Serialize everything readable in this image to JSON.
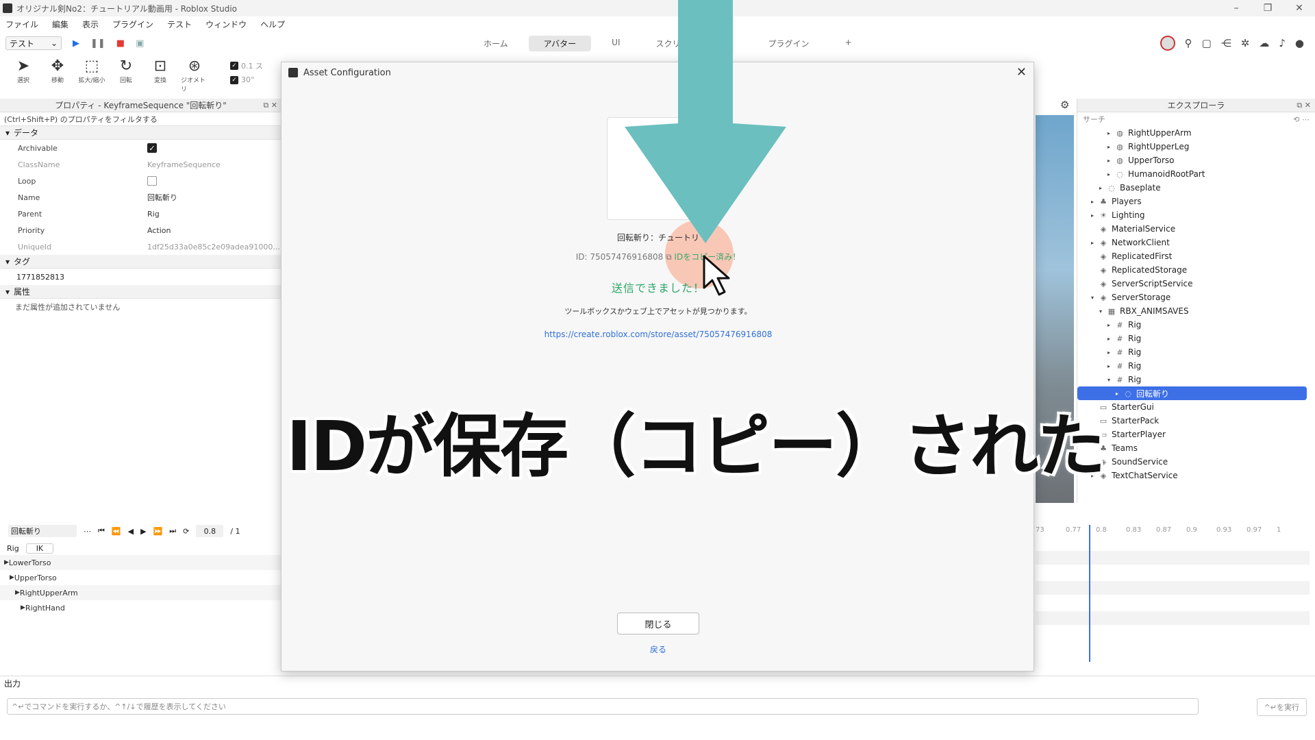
{
  "window": {
    "title": "オリジナル剣No2：チュートリアル動画用 - Roblox Studio"
  },
  "menu": [
    "ファイル",
    "編集",
    "表示",
    "プラグイン",
    "テスト",
    "ウィンドウ",
    "ヘルプ"
  ],
  "toolbar": {
    "test_select": "テスト",
    "ribbon_tabs": [
      "ホーム",
      "アバター",
      "UI",
      "スクリプト",
      "",
      "プラグイン",
      "+"
    ],
    "active_tab": "アバター",
    "tools": [
      {
        "label": "選択",
        "icon": "select-arrow-icon"
      },
      {
        "label": "移動",
        "icon": "move-icon"
      },
      {
        "label": "拡大/縮小",
        "icon": "scale-icon"
      },
      {
        "label": "回転",
        "icon": "rotate-icon"
      },
      {
        "label": "変換",
        "icon": "transform-icon"
      },
      {
        "label": "ジオメトリ",
        "icon": "geometry-icon"
      }
    ],
    "snap_move": "0.1 ス",
    "snap_rotate": "30°"
  },
  "properties": {
    "header": "プロパティ - KeyframeSequence \"回転斬り\"",
    "filter_placeholder": "(Ctrl+Shift+P) のプロパティをフィルタする",
    "section_data": "データ",
    "rows": [
      {
        "key": "Archivable",
        "value": "",
        "type": "checkbox",
        "checked": true
      },
      {
        "key": "ClassName",
        "value": "KeyframeSequence",
        "dim": true
      },
      {
        "key": "Loop",
        "value": "",
        "type": "checkbox",
        "checked": false
      },
      {
        "key": "Name",
        "value": "回転斬り"
      },
      {
        "key": "Parent",
        "value": "Rig"
      },
      {
        "key": "Priority",
        "value": "Action"
      },
      {
        "key": "UniqueId",
        "value": "1df25d33a0e85c2e09adea91000...",
        "dim": true
      }
    ],
    "section_tags": "タグ",
    "tag_value": "1771852813",
    "section_attributes": "属性",
    "attributes_empty": "まだ属性が追加されていません"
  },
  "explorer": {
    "header": "エクスプローラ",
    "search_placeholder": "サーチ",
    "items": [
      {
        "label": "RightUpperArm",
        "indent": 3,
        "arrow": "▸",
        "icon": "◍"
      },
      {
        "label": "RightUpperLeg",
        "indent": 3,
        "arrow": "▸",
        "icon": "◍"
      },
      {
        "label": "UpperTorso",
        "indent": 3,
        "arrow": "▸",
        "icon": "◍"
      },
      {
        "label": "HumanoidRootPart",
        "indent": 3,
        "arrow": "▸",
        "icon": "◌"
      },
      {
        "label": "Baseplate",
        "indent": 2,
        "arrow": "▸",
        "icon": "◌"
      },
      {
        "label": "Players",
        "indent": 1,
        "arrow": "▸",
        "icon": "♣"
      },
      {
        "label": "Lighting",
        "indent": 1,
        "arrow": "▸",
        "icon": "☀"
      },
      {
        "label": "MaterialService",
        "indent": 1,
        "arrow": "",
        "icon": "◈"
      },
      {
        "label": "NetworkClient",
        "indent": 1,
        "arrow": "▸",
        "icon": "◈"
      },
      {
        "label": "ReplicatedFirst",
        "indent": 1,
        "arrow": "",
        "icon": "◈"
      },
      {
        "label": "ReplicatedStorage",
        "indent": 1,
        "arrow": "",
        "icon": "◈"
      },
      {
        "label": "ServerScriptService",
        "indent": 1,
        "arrow": "",
        "icon": "◈"
      },
      {
        "label": "ServerStorage",
        "indent": 1,
        "arrow": "▾",
        "icon": "◈"
      },
      {
        "label": "RBX_ANIMSAVES",
        "indent": 2,
        "arrow": "▾",
        "icon": "▦"
      },
      {
        "label": "Rig",
        "indent": 3,
        "arrow": "▸",
        "icon": "#"
      },
      {
        "label": "Rig",
        "indent": 3,
        "arrow": "▸",
        "icon": "#"
      },
      {
        "label": "Rig",
        "indent": 3,
        "arrow": "▸",
        "icon": "#"
      },
      {
        "label": "Rig",
        "indent": 3,
        "arrow": "▸",
        "icon": "#"
      },
      {
        "label": "Rig",
        "indent": 3,
        "arrow": "▾",
        "icon": "#"
      },
      {
        "label": "回転斬り",
        "indent": 4,
        "arrow": "▸",
        "icon": "◌",
        "selected": true
      },
      {
        "label": "StarterGui",
        "indent": 1,
        "arrow": "",
        "icon": "▭"
      },
      {
        "label": "StarterPack",
        "indent": 1,
        "arrow": "",
        "icon": "▭"
      },
      {
        "label": "StarterPlayer",
        "indent": 1,
        "arrow": "▸",
        "icon": "▭"
      },
      {
        "label": "Teams",
        "indent": 1,
        "arrow": "",
        "icon": "♣"
      },
      {
        "label": "SoundService",
        "indent": 1,
        "arrow": "",
        "icon": "◈"
      },
      {
        "label": "TextChatService",
        "indent": 1,
        "arrow": "▸",
        "icon": "◈"
      }
    ]
  },
  "animation": {
    "name": "回転斬り",
    "time": "0.8",
    "time_sep": "/ 1",
    "rig_label": "Rig",
    "ik_label": "IK",
    "tracks": [
      {
        "label": "LowerTorso",
        "indent": 0
      },
      {
        "label": "UpperTorso",
        "indent": 1
      },
      {
        "label": "RightUpperArm",
        "indent": 2
      },
      {
        "label": "RightHand",
        "indent": 3
      }
    ],
    "ticks": [
      "73",
      "0.77",
      "0.8",
      "0.83",
      "0.87",
      "0.9",
      "0.93",
      "0.97",
      "1"
    ]
  },
  "output": {
    "label": "出力",
    "command_placeholder": "^↵でコマンドを実行するか、^↑/↓で履歴を表示してください",
    "run_label": "^↵を実行"
  },
  "modal": {
    "title": "Asset Configuration",
    "asset_name": "回転斬り：チュートリ",
    "id_text": "ID: 75057476916808",
    "copied_text": "IDをコピー済み！",
    "success": "送信できました！",
    "info": "ツールボックスかウェブ上でアセットが見つかります。",
    "url": "https://create.roblox.com/store/asset/75057476916808",
    "close_label": "閉じる",
    "back_label": "戻る"
  },
  "caption": "IDが保存（コピー）された",
  "colors": {
    "arrow": "#6bbfbf",
    "success_green": "#2ea66b",
    "link_blue": "#2f6fdb",
    "selection_blue": "#3d6fe6",
    "highlight": "#faa082"
  }
}
